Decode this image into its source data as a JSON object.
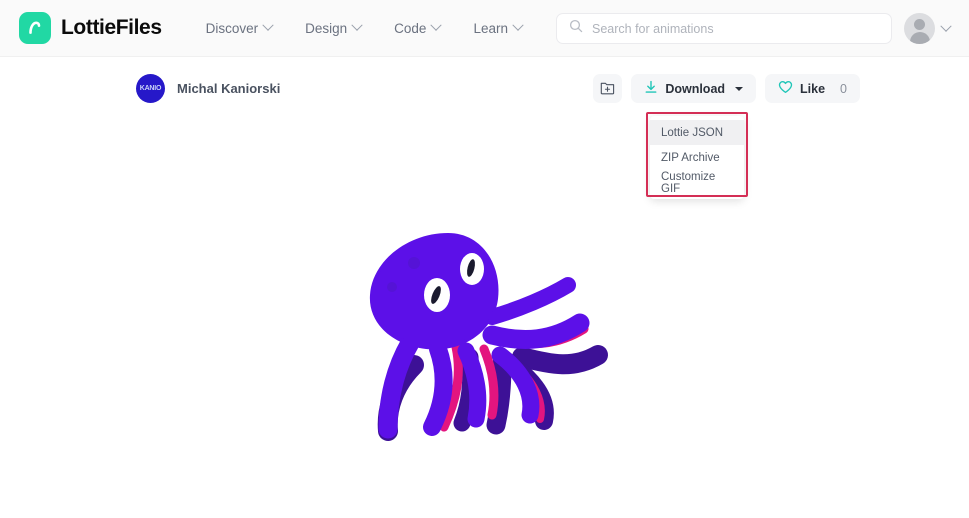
{
  "header": {
    "logo_icon": "lottiefiles-logo-icon",
    "brand_name": "LottieFiles",
    "brand_color": "#21D8A4",
    "nav": [
      {
        "label": "Discover",
        "icon": "chevron-down-icon"
      },
      {
        "label": "Design",
        "icon": "chevron-down-icon"
      },
      {
        "label": "Code",
        "icon": "chevron-down-icon"
      },
      {
        "label": "Learn",
        "icon": "chevron-down-icon"
      }
    ],
    "search": {
      "icon": "search-icon",
      "placeholder": "Search for animations",
      "value": ""
    },
    "account": {
      "avatar_icon": "user-avatar-icon",
      "chevron_icon": "chevron-down-icon"
    }
  },
  "author": {
    "avatar_icon": "author-avatar-icon",
    "avatar_text": "KANIO",
    "avatar_color": "#2618C9",
    "name": "Michal Kaniorski"
  },
  "actions": {
    "add_to_folder": {
      "icon": "folder-plus-icon",
      "label": ""
    },
    "download": {
      "icon": "download-icon",
      "icon_color": "#21C6B8",
      "label": "Download",
      "caret_icon": "caret-down-icon"
    },
    "like": {
      "icon": "heart-icon",
      "icon_color": "#21C6B8",
      "label": "Like",
      "count": "0"
    }
  },
  "download_menu": {
    "items": [
      {
        "label": "Lottie JSON",
        "highlighted": true
      },
      {
        "label": "ZIP Archive",
        "highlighted": false
      },
      {
        "label": "Customize GIF",
        "highlighted": false
      }
    ],
    "annotation_color": "#D42E55"
  },
  "preview": {
    "artwork_name": "octopus-animation",
    "colors": {
      "body": "#5C10E8",
      "tentacle_dark": "#3D1196",
      "tentacle_pink": "#E3157F",
      "eye_white": "#FFFFFF",
      "pupil": "#1A1A2E"
    }
  }
}
